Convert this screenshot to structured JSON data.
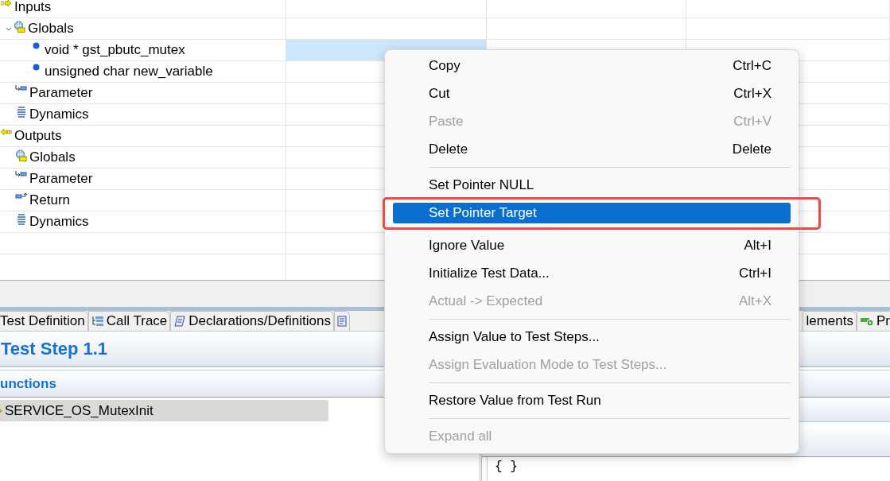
{
  "tree": [
    {
      "label": "Inputs",
      "kind": "inputs",
      "selected": false,
      "children": [
        {
          "label": "Globals",
          "kind": "globals",
          "expanded": true,
          "selected": false,
          "children": [
            {
              "label": "void * gst_pbutc_mutex",
              "kind": "variable",
              "selected": true
            },
            {
              "label": "unsigned char new_variable",
              "kind": "variable",
              "selected": false
            }
          ]
        },
        {
          "label": "Parameter",
          "kind": "parameter",
          "selected": false
        },
        {
          "label": "Dynamics",
          "kind": "dynamics",
          "selected": false
        }
      ]
    },
    {
      "label": "Outputs",
      "kind": "outputs",
      "selected": false,
      "children": [
        {
          "label": "Globals",
          "kind": "globals",
          "selected": false
        },
        {
          "label": "Parameter",
          "kind": "parameter",
          "selected": false
        },
        {
          "label": "Return",
          "kind": "return",
          "selected": false
        },
        {
          "label": "Dynamics",
          "kind": "dynamics",
          "selected": false
        }
      ]
    }
  ],
  "tabs": [
    {
      "label": "Test Definition",
      "kind": "plain",
      "selected": false
    },
    {
      "label": "Call Trace",
      "kind": "calltrace",
      "selected": false
    },
    {
      "label": "Declarations/Definitions",
      "kind": "declarations",
      "selected": false
    },
    {
      "kind": "doc",
      "selected": false
    },
    {
      "label": "lements",
      "kind": "plain",
      "selected": false
    },
    {
      "label": "Pr",
      "kind": "run",
      "selected": false
    }
  ],
  "panel": {
    "title": "Test Step 1.1",
    "section": "unctions",
    "function": "SERVICE_OS_MutexInit",
    "code": "{ }"
  },
  "context_menu": {
    "items": [
      {
        "kind": "item",
        "label": "Copy",
        "shortcut": "Ctrl+C",
        "disabled": false,
        "selected": false,
        "marked": false
      },
      {
        "kind": "item",
        "label": "Cut",
        "shortcut": "Ctrl+X",
        "disabled": false,
        "selected": false,
        "marked": false
      },
      {
        "kind": "item",
        "label": "Paste",
        "shortcut": "Ctrl+V",
        "disabled": true,
        "selected": false,
        "marked": false
      },
      {
        "kind": "item",
        "label": "Delete",
        "shortcut": "Delete",
        "disabled": false,
        "selected": false,
        "marked": false
      },
      {
        "kind": "separator"
      },
      {
        "kind": "item",
        "label": "Set Pointer NULL",
        "disabled": false,
        "selected": false,
        "marked": false
      },
      {
        "kind": "item",
        "label": "Set Pointer Target",
        "disabled": false,
        "selected": true,
        "marked": true
      },
      {
        "kind": "separator"
      },
      {
        "kind": "item",
        "label": "Ignore Value",
        "shortcut": "Alt+I",
        "disabled": false,
        "selected": false,
        "marked": false
      },
      {
        "kind": "item",
        "label": "Initialize Test Data...",
        "shortcut": "Ctrl+I",
        "disabled": false,
        "selected": false,
        "marked": false
      },
      {
        "kind": "item",
        "label": "Actual -> Expected",
        "shortcut": "Alt+X",
        "disabled": true,
        "selected": false,
        "marked": false
      },
      {
        "kind": "separator"
      },
      {
        "kind": "item",
        "label": "Assign Value to Test Steps...",
        "disabled": false,
        "selected": false,
        "marked": false
      },
      {
        "kind": "item",
        "label": "Assign Evaluation Mode to Test Steps...",
        "disabled": true,
        "selected": false,
        "marked": false
      },
      {
        "kind": "separator"
      },
      {
        "kind": "item",
        "label": "Restore Value from Test Run",
        "disabled": false,
        "selected": false,
        "marked": false
      },
      {
        "kind": "separator"
      },
      {
        "kind": "item",
        "label": "Expand all",
        "disabled": true,
        "selected": false,
        "marked": false
      }
    ]
  }
}
